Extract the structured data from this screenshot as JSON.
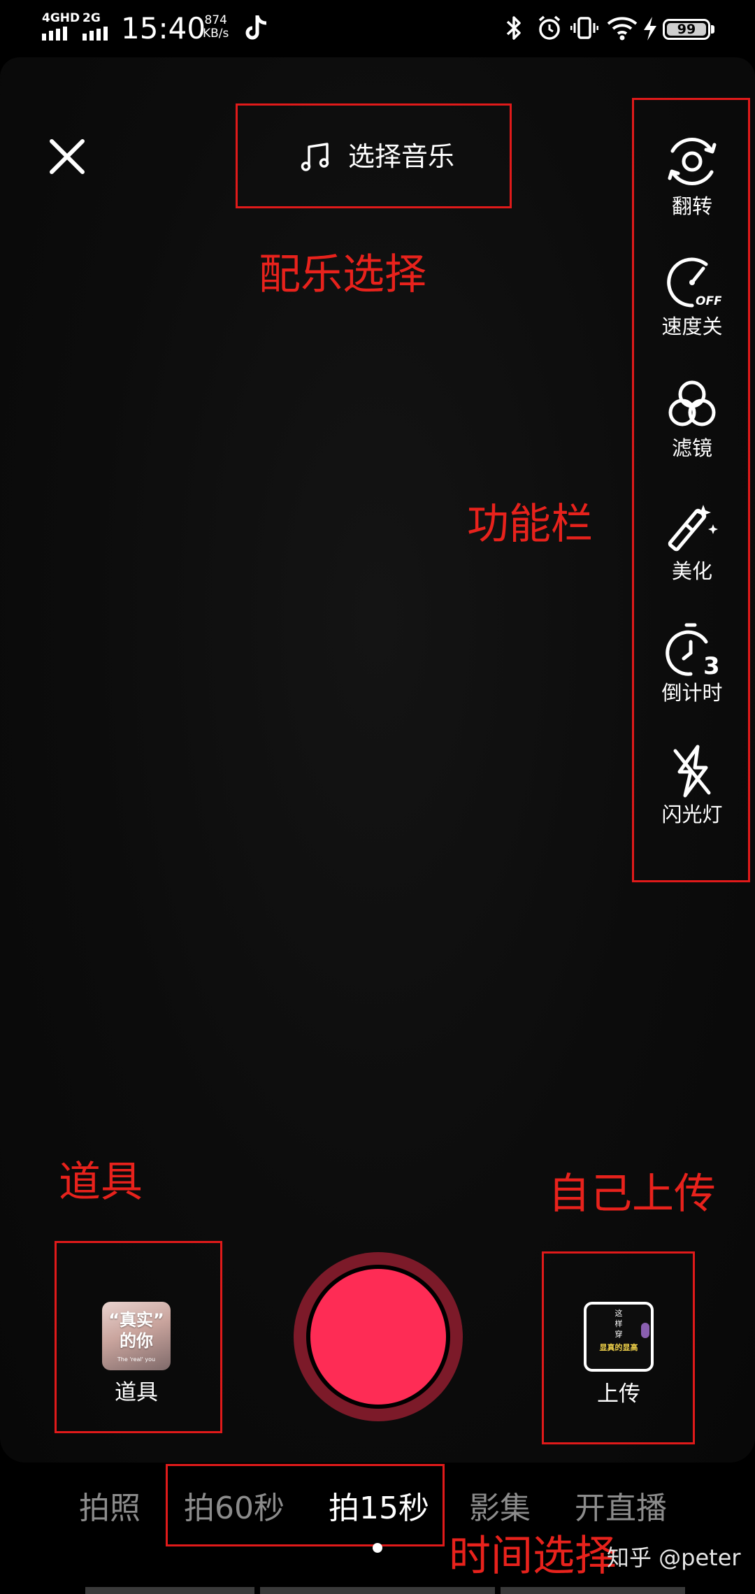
{
  "status_bar": {
    "network_1": "4GHD",
    "network_2": "2G",
    "time": "15:40",
    "speed_value": "874",
    "speed_unit": "KB/s",
    "battery": "99"
  },
  "top": {
    "close_icon": "close-icon",
    "music_label": "选择音乐"
  },
  "sidebar": {
    "items": [
      {
        "label": "翻转",
        "icon": "flip-camera-icon"
      },
      {
        "label": "速度关",
        "icon": "speed-off-icon"
      },
      {
        "label": "滤镜",
        "icon": "filter-icon"
      },
      {
        "label": "美化",
        "icon": "beauty-wand-icon"
      },
      {
        "label": "倒计时",
        "icon": "timer-3-icon"
      },
      {
        "label": "闪光灯",
        "icon": "flash-off-icon"
      }
    ]
  },
  "bottom": {
    "props_label": "道具",
    "props_thumb_text_1": "“真实”",
    "props_thumb_text_2": "的你",
    "props_thumb_caption": "The 'real' you",
    "upload_label": "上传",
    "upload_thumb_text_1": "这",
    "upload_thumb_text_2": "样",
    "upload_thumb_text_3": "穿",
    "upload_thumb_text_4": "显真的显高",
    "record_color": "#fe2c55"
  },
  "modes": [
    {
      "label": "拍照"
    },
    {
      "label": "拍60秒"
    },
    {
      "label": "拍15秒",
      "selected": true
    },
    {
      "label": "影集"
    },
    {
      "label": "开直播"
    }
  ],
  "annotations": {
    "music": "配乐选择",
    "toolbar": "功能栏",
    "props": "道具",
    "upload": "自己上传",
    "duration": "时间选择"
  },
  "watermark": "知乎 @peter"
}
